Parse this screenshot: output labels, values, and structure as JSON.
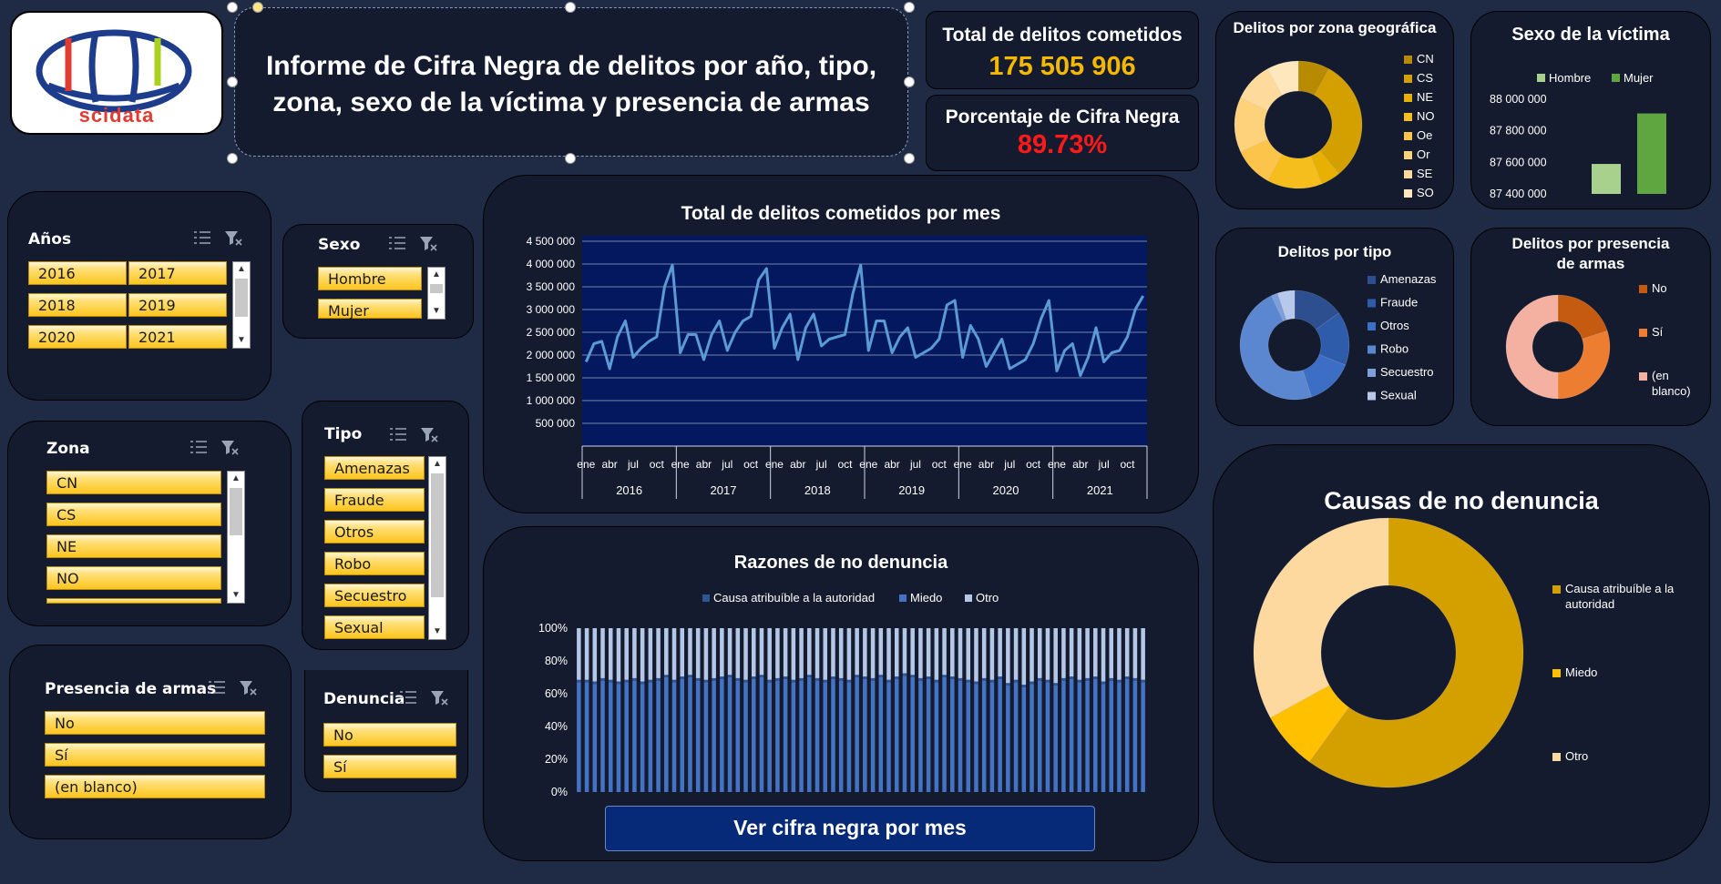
{
  "logo": {
    "text": "scidata"
  },
  "title": {
    "text": "Informe de Cifra Negra de delitos por año, tipo, zona, sexo de la víctima y presencia de armas"
  },
  "kpi": {
    "total_label": "Total de delitos cometidos",
    "total_value": "175 505 906",
    "pct_label": "Porcentaje de Cifra Negra",
    "pct_value": "89.73%"
  },
  "slicers": {
    "anios": {
      "title": "Años",
      "items": [
        "2016",
        "2017",
        "2018",
        "2019",
        "2020",
        "2021"
      ]
    },
    "sexo": {
      "title": "Sexo",
      "items": [
        "Hombre",
        "Mujer"
      ]
    },
    "zona": {
      "title": "Zona",
      "items": [
        "CN",
        "CS",
        "NE",
        "NO"
      ]
    },
    "tipo": {
      "title": "Tipo",
      "items": [
        "Amenazas",
        "Fraude",
        "Otros",
        "Robo",
        "Secuestro",
        "Sexual"
      ]
    },
    "armas": {
      "title": "Presencia de armas",
      "items": [
        "No",
        "Sí",
        "(en blanco)"
      ]
    },
    "denuncia": {
      "title": "Denuncia",
      "items": [
        "No",
        "Sí"
      ]
    }
  },
  "button": {
    "label": "Ver cifra negra por mes"
  },
  "colors": {
    "background": "#1f2b45",
    "panel": "#141b2e",
    "accent_gold": "#f5b800",
    "accent_red": "#ff1a1a",
    "line": "#5b9bd5",
    "plot_bg": "#03185e"
  },
  "chart_data": [
    {
      "id": "zona",
      "type": "pie",
      "title": "Delitos por zona geográfica",
      "donut": true,
      "categories": [
        "CN",
        "CS",
        "NE",
        "NO",
        "Oe",
        "Or",
        "SE",
        "SO"
      ],
      "values": [
        8,
        31,
        5,
        14,
        10,
        14,
        10,
        8
      ],
      "colors": [
        "#b88a00",
        "#d4a000",
        "#e8b000",
        "#f5be1c",
        "#fcc44a",
        "#fdd27a",
        "#fedb9c",
        "#fee6bd"
      ]
    },
    {
      "id": "sexo",
      "type": "bar",
      "title": "Sexo de la víctima",
      "series": [
        {
          "name": "Hombre",
          "values": [
            87590000
          ]
        },
        {
          "name": "Mujer",
          "values": [
            87910000
          ]
        }
      ],
      "ylim": [
        87400000,
        88000000
      ],
      "yticks": [
        "87 400 000",
        "87 600 000",
        "87 800 000",
        "88 000 000"
      ],
      "colors": [
        "#a9d18e",
        "#5fa640"
      ]
    },
    {
      "id": "tipo",
      "type": "pie",
      "title": "Delitos por tipo",
      "donut": true,
      "categories": [
        "Amenazas",
        "Fraude",
        "Otros",
        "Robo",
        "Secuestro",
        "Sexual"
      ],
      "values": [
        15,
        16,
        14,
        48,
        2,
        5
      ],
      "colors": [
        "#2d4f8f",
        "#2f5caa",
        "#3b6ec4",
        "#5b86d0",
        "#7f9fdb",
        "#b7c8ea"
      ]
    },
    {
      "id": "armas",
      "type": "pie",
      "title": "Delitos por presencia de armas",
      "donut": true,
      "categories": [
        "No",
        "Sí",
        "(en blanco)"
      ],
      "values": [
        20,
        30,
        50
      ],
      "colors": [
        "#c55a11",
        "#ed7d31",
        "#f4b0a0"
      ]
    },
    {
      "id": "mes",
      "type": "line",
      "title": "Total de delitos cometidos por mes",
      "years": [
        "2016",
        "2017",
        "2018",
        "2019",
        "2020",
        "2021"
      ],
      "month_labels": [
        "ene",
        "abr",
        "jul",
        "oct"
      ],
      "yticks": [
        "500 000",
        "1 000 000",
        "1 500 000",
        "2 000 000",
        "2 500 000",
        "3 000 000",
        "3 500 000",
        "4 000 000",
        "4 500 000"
      ],
      "ylim": [
        0,
        4500000
      ],
      "values": [
        1850000,
        2250000,
        2300000,
        1700000,
        2400000,
        2750000,
        1950000,
        2150000,
        2300000,
        2400000,
        3500000,
        3980000,
        2050000,
        2450000,
        2450000,
        1900000,
        2450000,
        2750000,
        2100000,
        2500000,
        2750000,
        2850000,
        3650000,
        3900000,
        2150000,
        2600000,
        2900000,
        1900000,
        2600000,
        2900000,
        2200000,
        2350000,
        2400000,
        2450000,
        3350000,
        3980000,
        2100000,
        2750000,
        2750000,
        2050000,
        2400000,
        2600000,
        1950000,
        2050000,
        2150000,
        2350000,
        3100000,
        3200000,
        1950000,
        2650000,
        2350000,
        1750000,
        2050000,
        2350000,
        1700000,
        1800000,
        1900000,
        2250000,
        2800000,
        3200000,
        1650000,
        2100000,
        2250000,
        1550000,
        1950000,
        2600000,
        1850000,
        2050000,
        2100000,
        2400000,
        3000000,
        3300000
      ]
    },
    {
      "id": "razones",
      "type": "bar",
      "stacked": "percent",
      "title": "Razones de no denuncia",
      "series_names": [
        "Causa atribuíble a la autoridad",
        "Miedo",
        "Otro"
      ],
      "yticks": [
        "0%",
        "20%",
        "40%",
        "60%",
        "80%",
        "100%"
      ],
      "values_causa": [
        67,
        67,
        66,
        68,
        67,
        66,
        67,
        68,
        66,
        67,
        68,
        70,
        67,
        69,
        70,
        68,
        67,
        68,
        69,
        70,
        68,
        67,
        69,
        70,
        67,
        68,
        69,
        67,
        68,
        70,
        68,
        67,
        69,
        68,
        67,
        70,
        69,
        68,
        70,
        67,
        69,
        71,
        70,
        68,
        69,
        67,
        70,
        69,
        68,
        67,
        66,
        68,
        67,
        69,
        65,
        67,
        64,
        66,
        68,
        67,
        65,
        68,
        69,
        67,
        68,
        69,
        66,
        68,
        67,
        69,
        68,
        67
      ],
      "miedo_pct": 1.5
    },
    {
      "id": "causas",
      "type": "pie",
      "title": "Causas de no denuncia",
      "donut": true,
      "categories": [
        "Causa atribuíble a la autoridad",
        "Miedo",
        "Otro"
      ],
      "values": [
        60,
        7,
        33
      ],
      "colors": [
        "#d4a000",
        "#ffc000",
        "#fdd9a0"
      ]
    }
  ]
}
